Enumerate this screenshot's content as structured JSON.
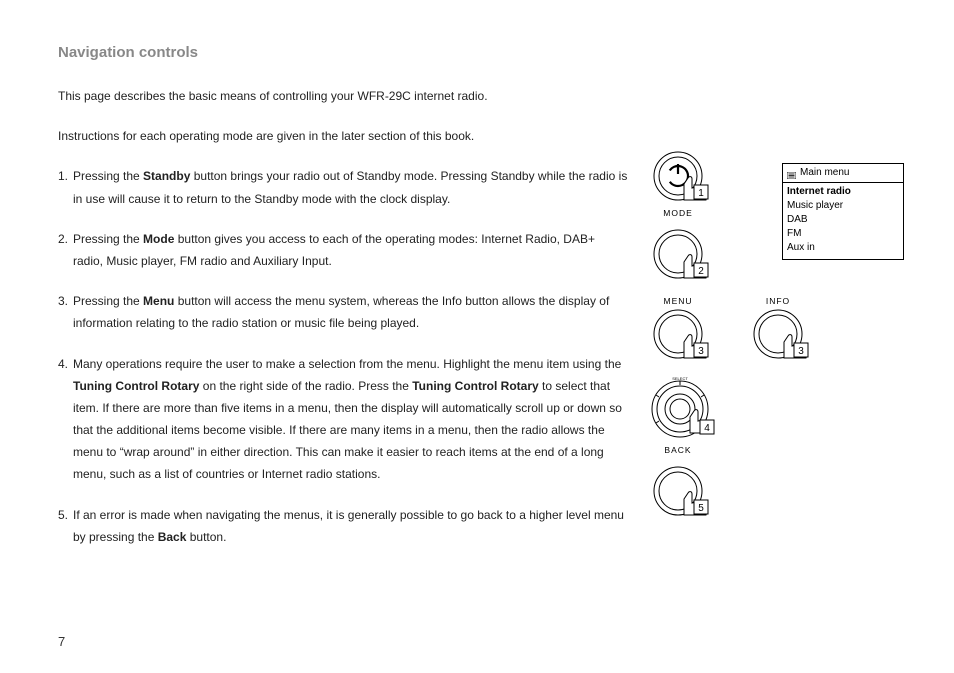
{
  "page_number": "7",
  "title": "Navigation controls",
  "intro1": "This page describes the basic means of controlling your WFR-29C internet radio.",
  "intro2": "Instructions for each operating mode are given in the later section of this book.",
  "items": {
    "n1": "1.",
    "n2": "2.",
    "n3": "3.",
    "n4": "4.",
    "n5": "5.",
    "p1a": "Pressing the ",
    "p1b": "Standby",
    "p1c": " button brings your radio out of Standby mode. Pressing Standby while the radio is in use will cause it to return to the Standby mode with the clock display.",
    "p2a": "Pressing the ",
    "p2b": "Mode",
    "p2c": " button gives you access to each of the operating modes: Internet Radio, DAB+ radio, Music player, FM radio and Auxiliary Input.",
    "p3a": "Pressing the ",
    "p3b": "Menu",
    "p3c": " button will access the menu system, whereas the Info button allows the display of information relating to the radio station or music file being played.",
    "p4a": "Many operations require the user to make a selection from the menu. Highlight the menu item using the ",
    "p4b": "Tuning Control Rotary",
    "p4c": " on the right side of the radio. Press the ",
    "p4d": "Tuning Control Rotary",
    "p4e": " to select that item. If there are more than five items in a menu, then the display will automatically scroll up or down so that the additional items become visible. If there are many items in a menu, then the radio allows the menu to “wrap around” in either direction. This can make it easier to reach items at the end of a long menu, such as a list of countries or Internet radio stations.",
    "p5a": "If an error is made when navigating the menus, it is generally possible to go back to a higher level menu by pressing the ",
    "p5b": "Back",
    "p5c": " button."
  },
  "labels": {
    "mode": "MODE",
    "menu": "MENU",
    "info": "INFO",
    "back": "BACK"
  },
  "callouts": {
    "c1": "1",
    "c2": "2",
    "c3a": "3",
    "c3b": "3",
    "c4": "4",
    "c5": "5"
  },
  "menu": {
    "title": "Main menu",
    "i0": "Internet radio",
    "i1": "Music player",
    "i2": "DAB",
    "i3": "FM",
    "i4": "Aux in"
  }
}
